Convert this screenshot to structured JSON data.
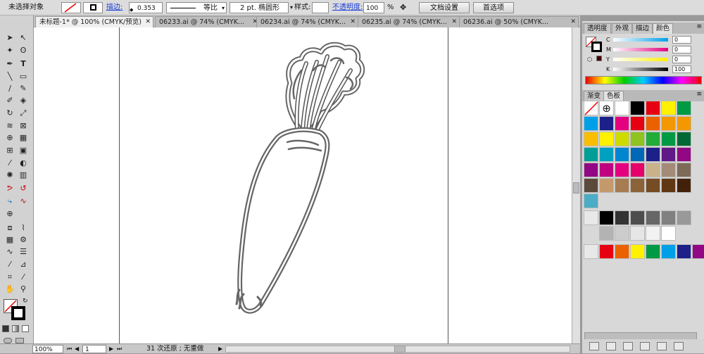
{
  "control_bar": {
    "selection_status": "未选择对象",
    "stroke_label": "描边:",
    "stroke_weight": "0.353",
    "stroke_profile": "等比",
    "brush_name": "2 pt. 椭圆形",
    "style_label": "样式:",
    "opacity_label": "不透明度:",
    "opacity_value": "100",
    "opacity_unit": "%",
    "doc_setup_button": "文档设置",
    "preferences_button": "首选项"
  },
  "tabs": [
    {
      "label": "未标题-1* @ 100% (CMYK/预览)",
      "active": true
    },
    {
      "label": "06233.ai @ 74% (CMYK...",
      "active": false
    },
    {
      "label": "06234.ai @ 74% (CMYK...",
      "active": false
    },
    {
      "label": "06235.ai @ 74% (CMYK...",
      "active": false
    },
    {
      "label": "06236.ai @ 50% (CMYK...",
      "active": false
    }
  ],
  "status_bar": {
    "zoom": "100%",
    "page": "1",
    "history": "31 次还原 ; 无重做"
  },
  "color_panel": {
    "tabs": [
      "透明度",
      "外观",
      "描边",
      "颜色"
    ],
    "active_tab": "颜色",
    "channels": [
      {
        "label": "C",
        "value": "0"
      },
      {
        "label": "M",
        "value": "0"
      },
      {
        "label": "Y",
        "value": "0"
      },
      {
        "label": "K",
        "value": "100"
      }
    ]
  },
  "swatch_panel": {
    "tabs": [
      "渐变",
      "色板"
    ],
    "active_tab": "色板",
    "rows": [
      [
        "#ffffff",
        "#ffffff",
        "#ffffff",
        "#000000",
        "#e60012",
        "#fff100",
        "#009944"
      ],
      [
        "#00a0e9",
        "#1d2088",
        "#e4007f",
        "#e60012",
        "#eb6100",
        "#f39800",
        "#f39800"
      ],
      [
        "#fabe00",
        "#fff100",
        "#cfdb00",
        "#8fc31f",
        "#22ac38",
        "#009944",
        "#006934"
      ],
      [
        "#009e96",
        "#00a0c1",
        "#0086d1",
        "#0068b7",
        "#1d2088",
        "#601986",
        "#920783"
      ],
      [
        "#920783",
        "#be0081",
        "#e4007f",
        "#e5006a",
        "#c9b28a",
        "#a48b78",
        "#7d6b57"
      ],
      [
        "#5b4a3b",
        "#c49a6c",
        "#a67c52",
        "#8c6239",
        "#754c24",
        "#603813",
        "#42210b"
      ]
    ],
    "extra_swatch": "#4bacc6",
    "gray_row": [
      "#000000",
      "#333333",
      "#4d4d4d",
      "#666666",
      "#808080",
      "#999999"
    ],
    "gray_row2": [
      "#b3b3b3",
      "#cccccc",
      "#e6e6e6",
      "#f2f2f2",
      "#ffffff"
    ],
    "bright_row": [
      "#e60012",
      "#eb6100",
      "#fff100",
      "#009944",
      "#00a0e9",
      "#1d2088",
      "#920783"
    ]
  }
}
